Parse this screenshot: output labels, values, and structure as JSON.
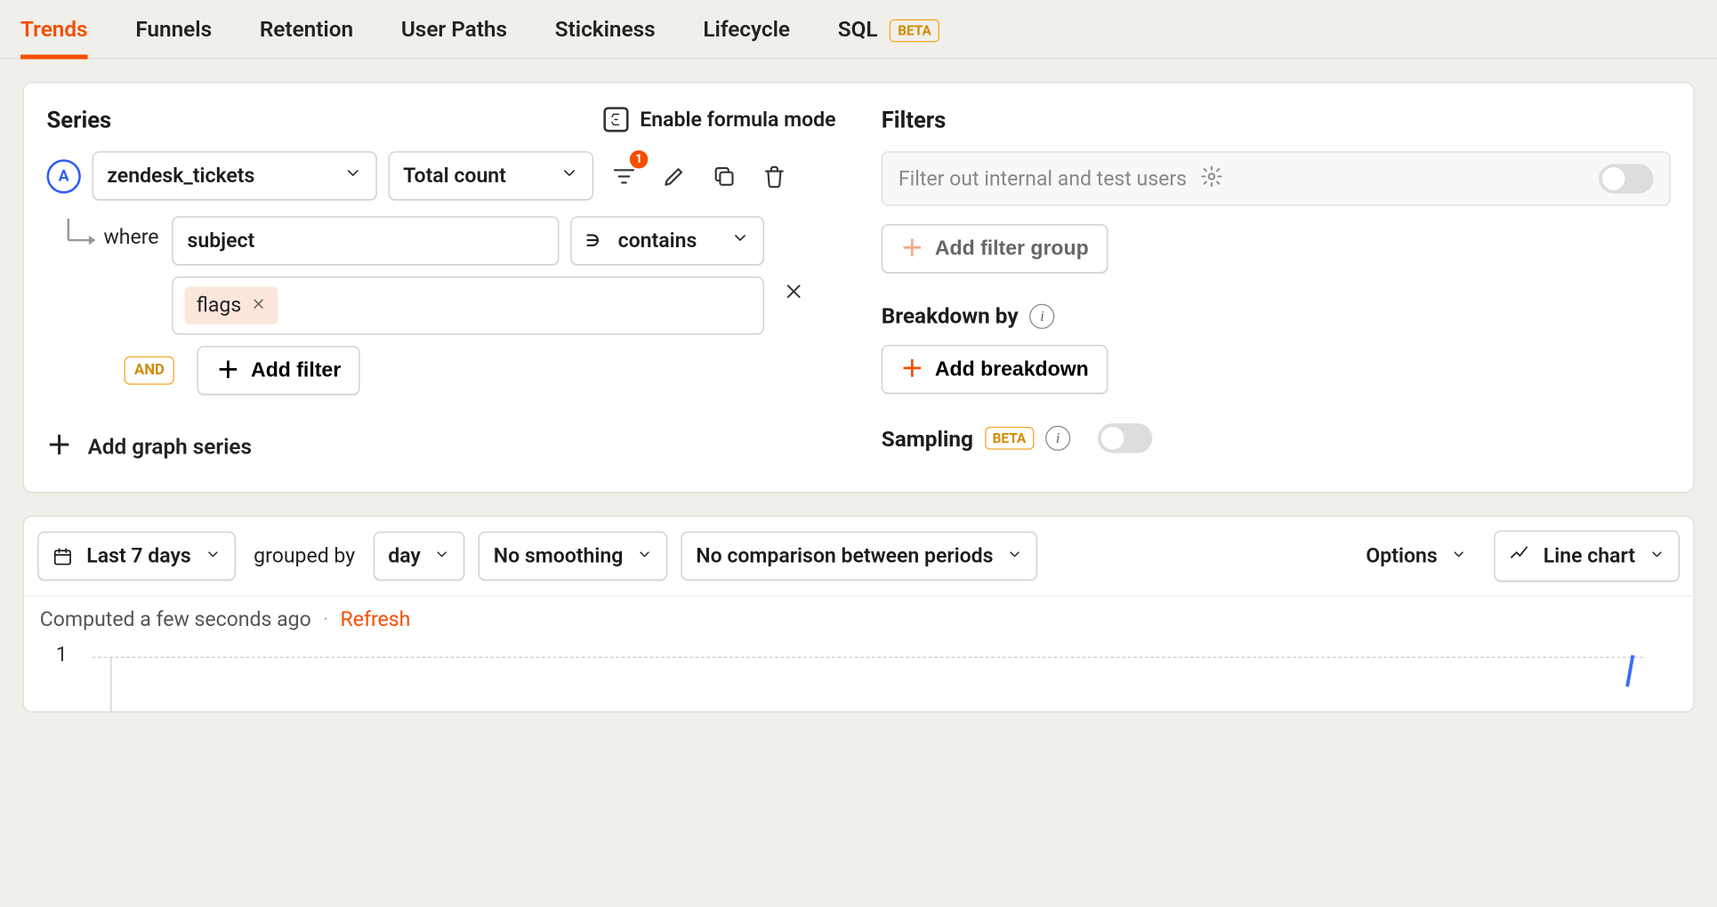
{
  "tabs": [
    {
      "label": "Trends",
      "active": true
    },
    {
      "label": "Funnels"
    },
    {
      "label": "Retention"
    },
    {
      "label": "User Paths"
    },
    {
      "label": "Stickiness"
    },
    {
      "label": "Lifecycle"
    },
    {
      "label": "SQL",
      "beta": "BETA"
    }
  ],
  "series": {
    "title": "Series",
    "formula_label": "Enable formula mode",
    "letter": "A",
    "event": "zendesk_tickets",
    "agg": "Total count",
    "filter_badge": "1",
    "where_label": "where",
    "prop": "subject",
    "op": "contains",
    "chip": "flags",
    "and_pill": "AND",
    "add_filter": "Add filter",
    "add_series": "Add graph series"
  },
  "filters": {
    "title": "Filters",
    "placeholder": "Filter out internal and test users",
    "add_group": "Add filter group",
    "breakdown_title": "Breakdown by",
    "add_breakdown": "Add breakdown",
    "sampling_title": "Sampling",
    "sampling_beta": "BETA"
  },
  "toolbar": {
    "range": "Last 7 days",
    "grouped_label": "grouped by",
    "interval": "day",
    "smoothing": "No smoothing",
    "comparison": "No comparison between periods",
    "options": "Options",
    "chart_type": "Line chart"
  },
  "status": {
    "computed": "Computed a few seconds ago",
    "refresh": "Refresh"
  },
  "chart_data": {
    "type": "line",
    "y_tick": "1",
    "ylim": [
      0,
      1
    ],
    "series": [
      {
        "name": "zendesk_tickets",
        "values": [
          1
        ]
      }
    ]
  }
}
